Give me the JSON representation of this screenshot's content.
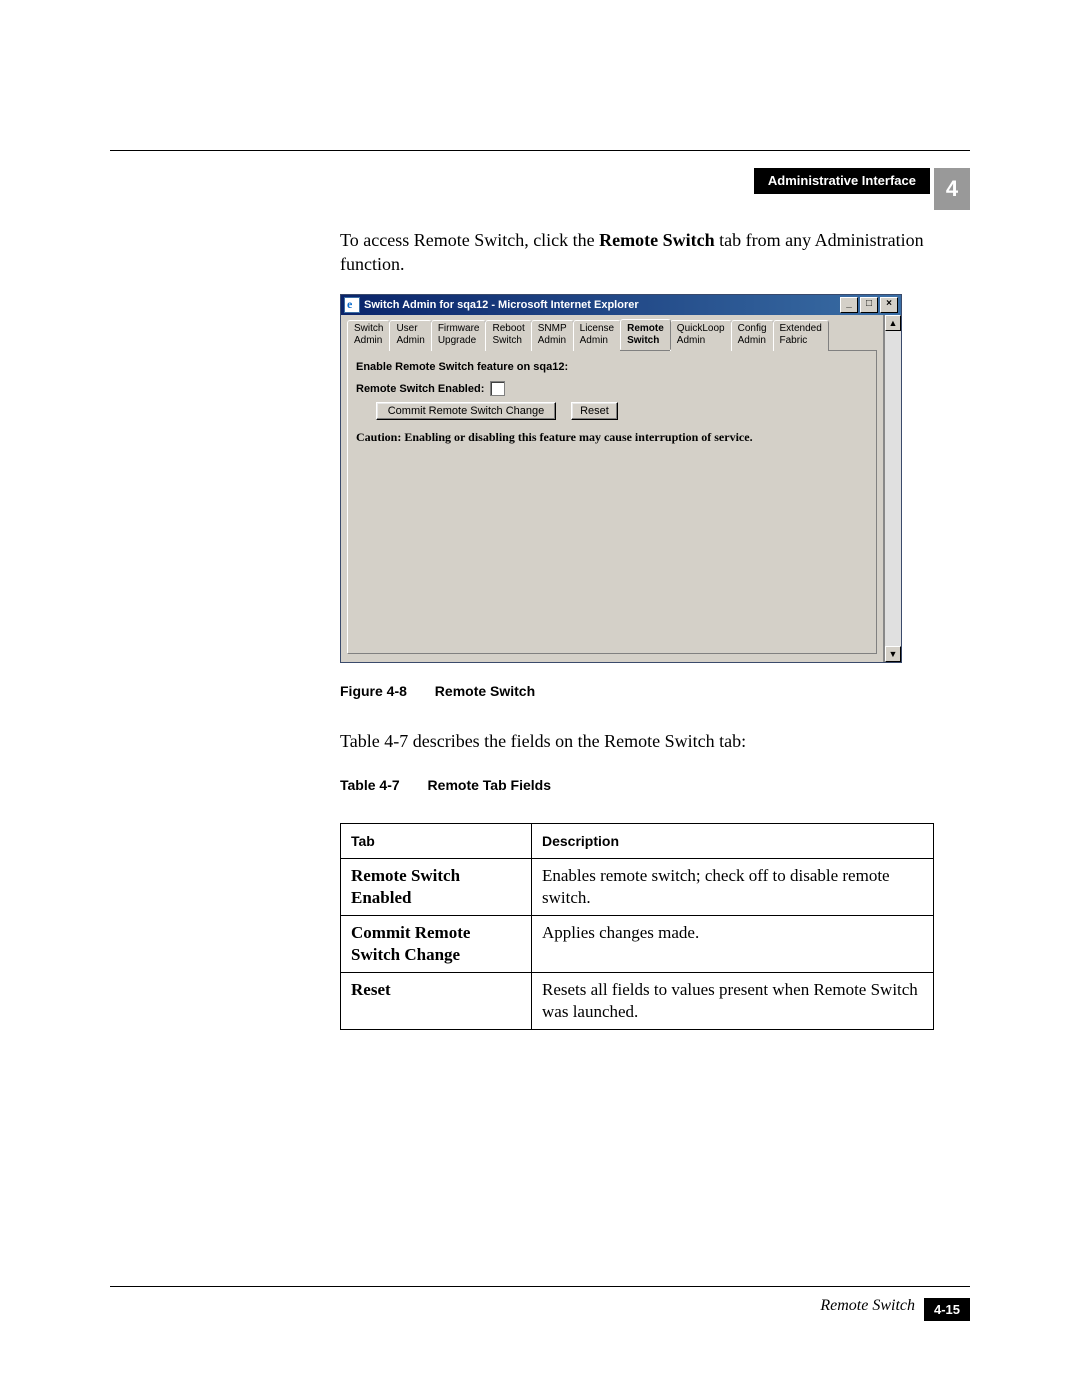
{
  "header": {
    "section_label": "Administrative Interface",
    "chapter_number": "4"
  },
  "intro": {
    "prefix": "To access Remote Switch, click the ",
    "bold": "Remote Switch",
    "suffix": " tab from any Administration function."
  },
  "screenshot": {
    "window_title": "Switch Admin for sqa12 - Microsoft Internet Explorer",
    "win_btn_min": "_",
    "win_btn_max": "□",
    "win_btn_close": "×",
    "scroll_up": "▲",
    "scroll_down": "▼",
    "tabs": [
      "Switch\nAdmin",
      "User\nAdmin",
      "Firmware\nUpgrade",
      "Reboot\nSwitch",
      "SNMP\nAdmin",
      "License\nAdmin",
      "Remote\nSwitch",
      "QuickLoop\nAdmin",
      "Config\nAdmin",
      "Extended\nFabric"
    ],
    "active_tab_index": 6,
    "panel_heading": "Enable Remote Switch feature on sqa12:",
    "enabled_label": "Remote Switch Enabled:",
    "btn_commit": "Commit Remote Switch Change",
    "btn_reset": "Reset",
    "caution_label": "Caution:",
    "caution_text": "Enabling or disabling this feature may cause interruption of service."
  },
  "figure": {
    "number": "Figure 4-8",
    "title": "Remote Switch"
  },
  "table_intro": "Table 4-7 describes the fields on the Remote Switch tab:",
  "table": {
    "number": "Table 4-7",
    "title": "Remote Tab Fields",
    "head_tab": "Tab",
    "head_desc": "Description",
    "rows": [
      {
        "tab": "Remote Switch Enabled",
        "desc": "Enables remote switch; check off to disable remote switch."
      },
      {
        "tab": "Commit Remote Switch Change",
        "desc": "Applies changes made."
      },
      {
        "tab": "Reset",
        "desc": "Resets all fields to values present when Remote Switch was launched."
      }
    ]
  },
  "footer": {
    "title": "Remote Switch",
    "page": "4-15"
  }
}
